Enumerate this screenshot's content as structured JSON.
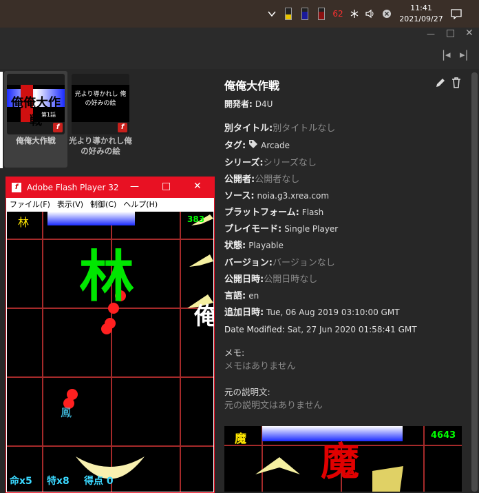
{
  "taskbar": {
    "battery_percent": "62",
    "time": "11:41",
    "date": "2021/09/27"
  },
  "library": {
    "cards": [
      {
        "title": "俺俺大作戦",
        "thumb_text": "俺俺大作戦",
        "thumb_sub": "第1話"
      },
      {
        "title": "光より導かれし俺の好みの絵",
        "thumb_text": "光より導かれし 俺の好みの絵"
      }
    ]
  },
  "flash_window": {
    "title": "Adobe Flash Player 32",
    "menu": [
      "ファイル(F)",
      "表示(V)",
      "制御(C)",
      "ヘルプ(H)"
    ],
    "game": {
      "top_left_kanji": "林",
      "score_partial": "383",
      "big_kanji": "林",
      "side_kanji": "俺",
      "player_char": "鳳",
      "status_lives": "命x5",
      "status_special": "特x8",
      "status_score": "得点 0"
    }
  },
  "detail": {
    "title": "俺俺大作戦",
    "developer_label": "開発者:",
    "developer": "D4U",
    "fields": [
      {
        "label": "別タイトル:",
        "value": "別タイトルなし",
        "dim": true
      },
      {
        "label": "タグ:",
        "value": "Arcade",
        "dim": false,
        "tag": true
      },
      {
        "label": "シリーズ:",
        "value": "シリーズなし",
        "dim": true
      },
      {
        "label": "公開者:",
        "value": "公開者なし",
        "dim": true
      },
      {
        "label": "ソース:",
        "value": "noia.g3.xrea.com",
        "dim": false
      },
      {
        "label": "プラットフォーム:",
        "value": "Flash",
        "dim": false
      },
      {
        "label": "プレイモード:",
        "value": "Single Player",
        "dim": false
      },
      {
        "label": "状態:",
        "value": "Playable",
        "dim": false
      },
      {
        "label": "バージョン:",
        "value": "バージョンなし",
        "dim": true
      },
      {
        "label": "公開日時:",
        "value": "公開日時なし",
        "dim": true
      },
      {
        "label": "言語:",
        "value": "en",
        "dim": false
      },
      {
        "label": "追加日時:",
        "value": " Tue, 06 Aug 2019 03:10:00 GMT",
        "dim": false
      },
      {
        "label": "Date Modified:",
        "value": " Sat, 27 Jun 2020 01:58:41 GMT",
        "dim": false
      }
    ],
    "notes_label": "メモ:",
    "notes_value": "メモはありません",
    "orig_desc_label": "元の説明文:",
    "orig_desc_value": "元の説明文はありません",
    "preview": {
      "kanji": "魔",
      "score": "4643",
      "big_kanji": "魔"
    }
  },
  "colors": {
    "accent_red": "#e81123",
    "bg": "#272727"
  }
}
